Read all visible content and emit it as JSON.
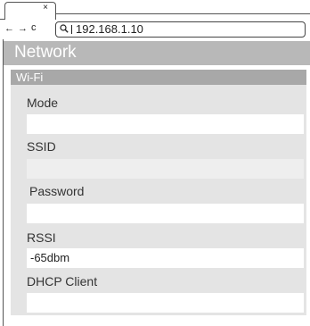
{
  "browser": {
    "tab_close": "×",
    "back": "←",
    "forward": "→",
    "reload": "c",
    "url": "192.168.1.10"
  },
  "page": {
    "title": "Network",
    "section": "Wi-Fi",
    "fields": {
      "mode": {
        "label": "Mode",
        "value": ""
      },
      "ssid": {
        "label": "SSID",
        "value": ""
      },
      "password": {
        "label": "Password",
        "value": ""
      },
      "rssi": {
        "label": "RSSI",
        "value": "-65dbm"
      },
      "dhcp": {
        "label": "DHCP Client",
        "value": ""
      }
    }
  }
}
